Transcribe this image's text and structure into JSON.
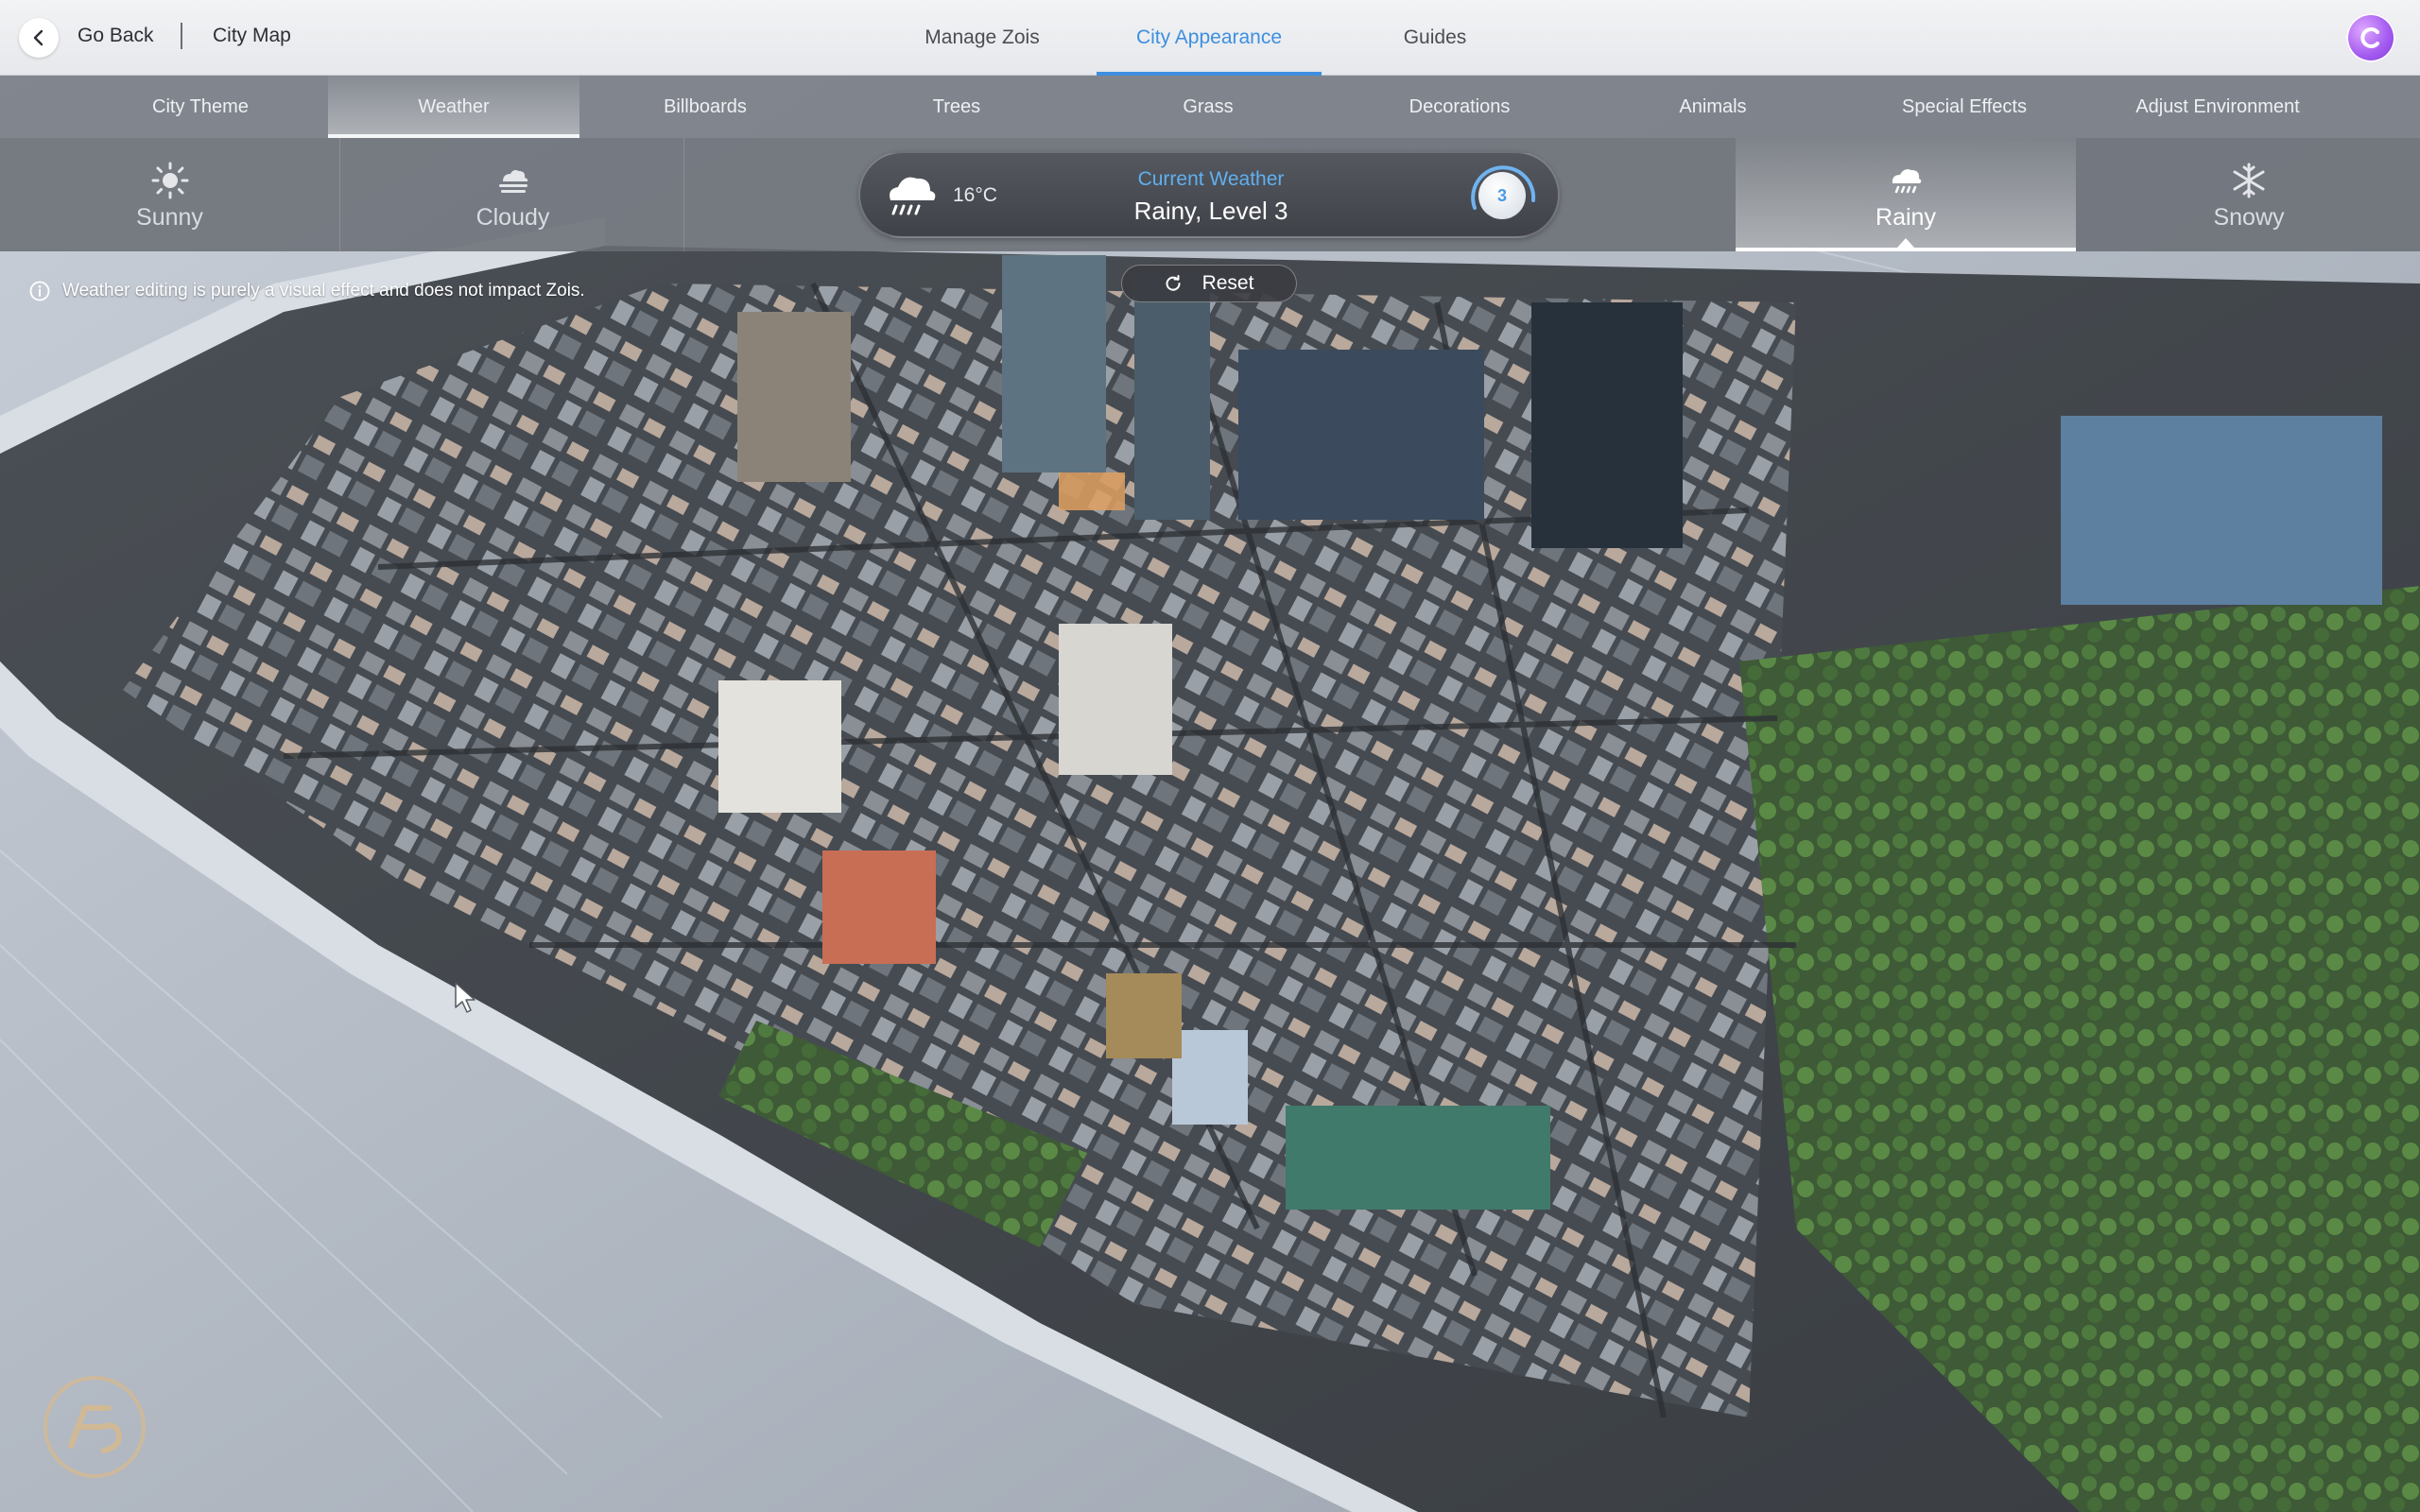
{
  "header": {
    "back_label": "Go Back",
    "breadcrumb": "City Map",
    "tabs": [
      {
        "label": "Manage Zois",
        "active": false
      },
      {
        "label": "City Appearance",
        "active": true
      },
      {
        "label": "Guides",
        "active": false
      }
    ],
    "avatar_icon": "user-avatar-icon"
  },
  "subnav": {
    "items": [
      {
        "label": "City Theme",
        "active": false
      },
      {
        "label": "Weather",
        "active": true
      },
      {
        "label": "Billboards",
        "active": false
      },
      {
        "label": "Trees",
        "active": false
      },
      {
        "label": "Grass",
        "active": false
      },
      {
        "label": "Decorations",
        "active": false
      },
      {
        "label": "Animals",
        "active": false
      },
      {
        "label": "Special Effects",
        "active": false
      },
      {
        "label": "Adjust Environment",
        "active": false
      }
    ]
  },
  "weather": {
    "options": [
      {
        "label": "Sunny",
        "icon": "sun-icon",
        "active": false
      },
      {
        "label": "Cloudy",
        "icon": "cloud-icon",
        "active": false
      },
      {
        "label": "Rainy",
        "icon": "rain-cloud-icon",
        "active": true
      },
      {
        "label": "Snowy",
        "icon": "snowflake-icon",
        "active": false
      }
    ],
    "current": {
      "title": "Current Weather",
      "value": "Rainy,  Level 3",
      "temperature": "16°C",
      "level": "3",
      "icon": "rain-cloud-icon"
    },
    "reset_label": "Reset",
    "info_text": "Weather editing is purely a visual effect and does not impact Zois."
  },
  "colors": {
    "accent": "#3d8fe0",
    "avatar": "#a45cf0"
  }
}
